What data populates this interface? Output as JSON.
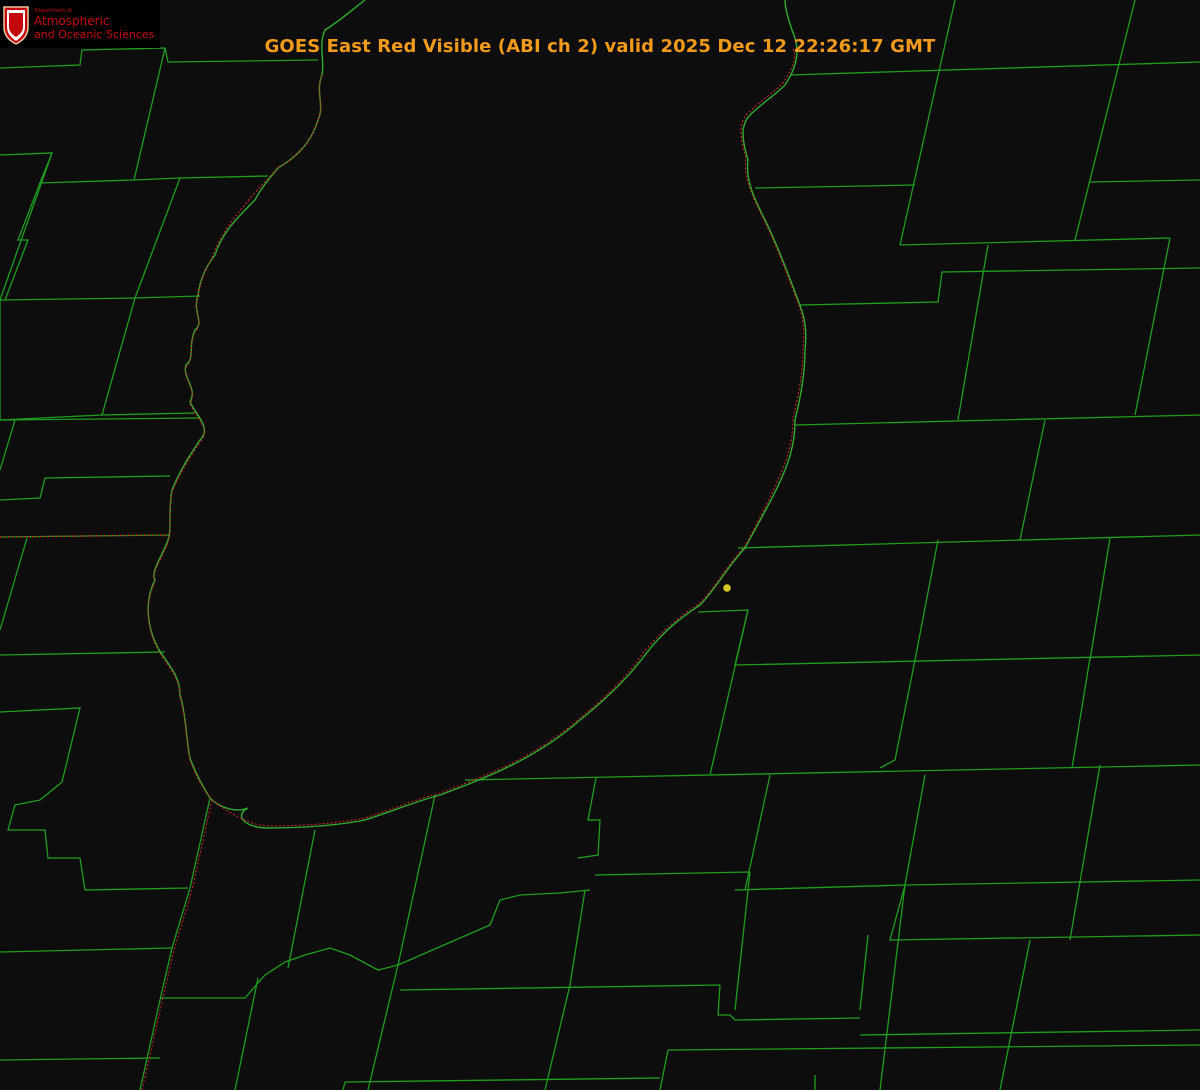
{
  "title": "GOES East Red Visible (ABI ch 2) valid 2025 Dec 12 22:26:17 GMT",
  "logo": {
    "department": "Department of",
    "line1": "Atmospheric",
    "line2": "and Oceanic Sciences",
    "seal_letter": "W"
  },
  "colors": {
    "background": "#0d0d0d",
    "county_lines": "#1f9e1f",
    "coastline": "#2fae2f",
    "coastline_dotted": "#c8282a",
    "title": "#f29a1a",
    "logo_red": "#c5050c",
    "station_marker": "#d6c622"
  },
  "layers": [
    "county-borders",
    "state-border",
    "lake-shoreline",
    "station-marker"
  ]
}
